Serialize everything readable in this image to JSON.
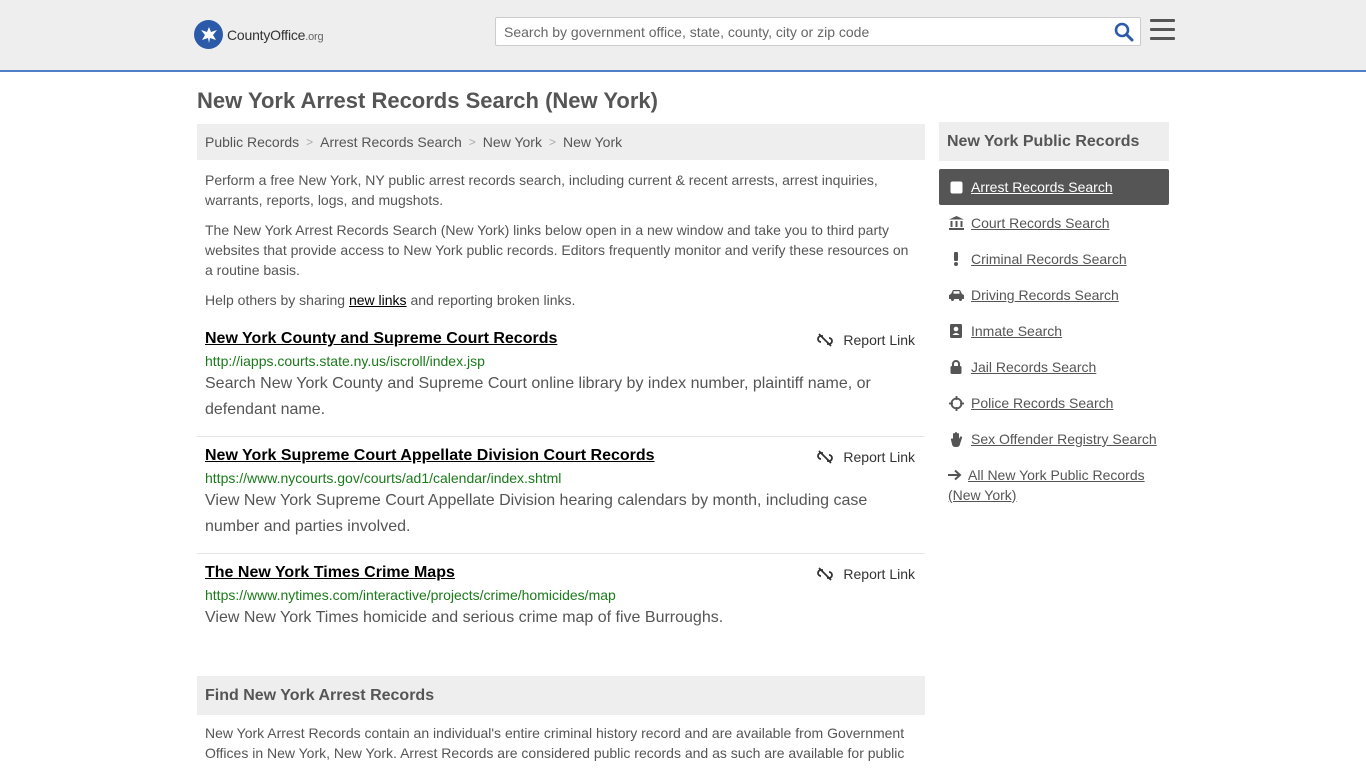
{
  "header": {
    "logo_main": "CountyOffice",
    "logo_tld": ".org",
    "search_placeholder": "Search by government office, state, county, city or zip code"
  },
  "page": {
    "title": "New York Arrest Records Search (New York)"
  },
  "breadcrumb": [
    "Public Records",
    "Arrest Records Search",
    "New York",
    "New York"
  ],
  "intro": {
    "p1": "Perform a free New York, NY public arrest records search, including current & recent arrests, arrest inquiries, warrants, reports, logs, and mugshots.",
    "p2": "The New York Arrest Records Search (New York) links below open in a new window and take you to third party websites that provide access to New York public records. Editors frequently monitor and verify these resources on a routine basis.",
    "p3_before": "Help others by sharing ",
    "p3_link": "new links",
    "p3_after": " and reporting broken links."
  },
  "records": [
    {
      "title": "New York County and Supreme Court Records",
      "url": "http://iapps.courts.state.ny.us/iscroll/index.jsp",
      "desc": "Search New York County and Supreme Court online library by index number, plaintiff name, or defendant name.",
      "report": "Report Link"
    },
    {
      "title": "New York Supreme Court Appellate Division Court Records",
      "url": "https://www.nycourts.gov/courts/ad1/calendar/index.shtml",
      "desc": "View New York Supreme Court Appellate Division hearing calendars by month, including case number and parties involved.",
      "report": "Report Link"
    },
    {
      "title": "The New York Times Crime Maps",
      "url": "https://www.nytimes.com/interactive/projects/crime/homicides/map",
      "desc": "View New York Times homicide and serious crime map of five Burroughs.",
      "report": "Report Link"
    }
  ],
  "find": {
    "title": "Find New York Arrest Records",
    "text": "New York Arrest Records contain an individual's entire criminal history record and are available from Government Offices in New York, New York. Arrest Records are considered public records and as such are available for public"
  },
  "sidebar": {
    "title": "New York Public Records",
    "items": [
      {
        "label": "Arrest Records Search",
        "icon": "square-icon"
      },
      {
        "label": "Court Records Search",
        "icon": "courthouse-icon"
      },
      {
        "label": "Criminal Records Search",
        "icon": "exclamation-icon"
      },
      {
        "label": "Driving Records Search",
        "icon": "car-icon"
      },
      {
        "label": "Inmate Search",
        "icon": "id-badge-icon"
      },
      {
        "label": "Jail Records Search",
        "icon": "lock-icon"
      },
      {
        "label": "Police Records Search",
        "icon": "crosshair-icon"
      },
      {
        "label": "Sex Offender Registry Search",
        "icon": "hand-icon"
      },
      {
        "label": "All New York Public Records (New York)",
        "icon": "arrow-right-icon"
      }
    ]
  },
  "colors": {
    "accent": "#4f80c7",
    "link_green": "#1a7a1a",
    "active_bg": "#555555"
  }
}
